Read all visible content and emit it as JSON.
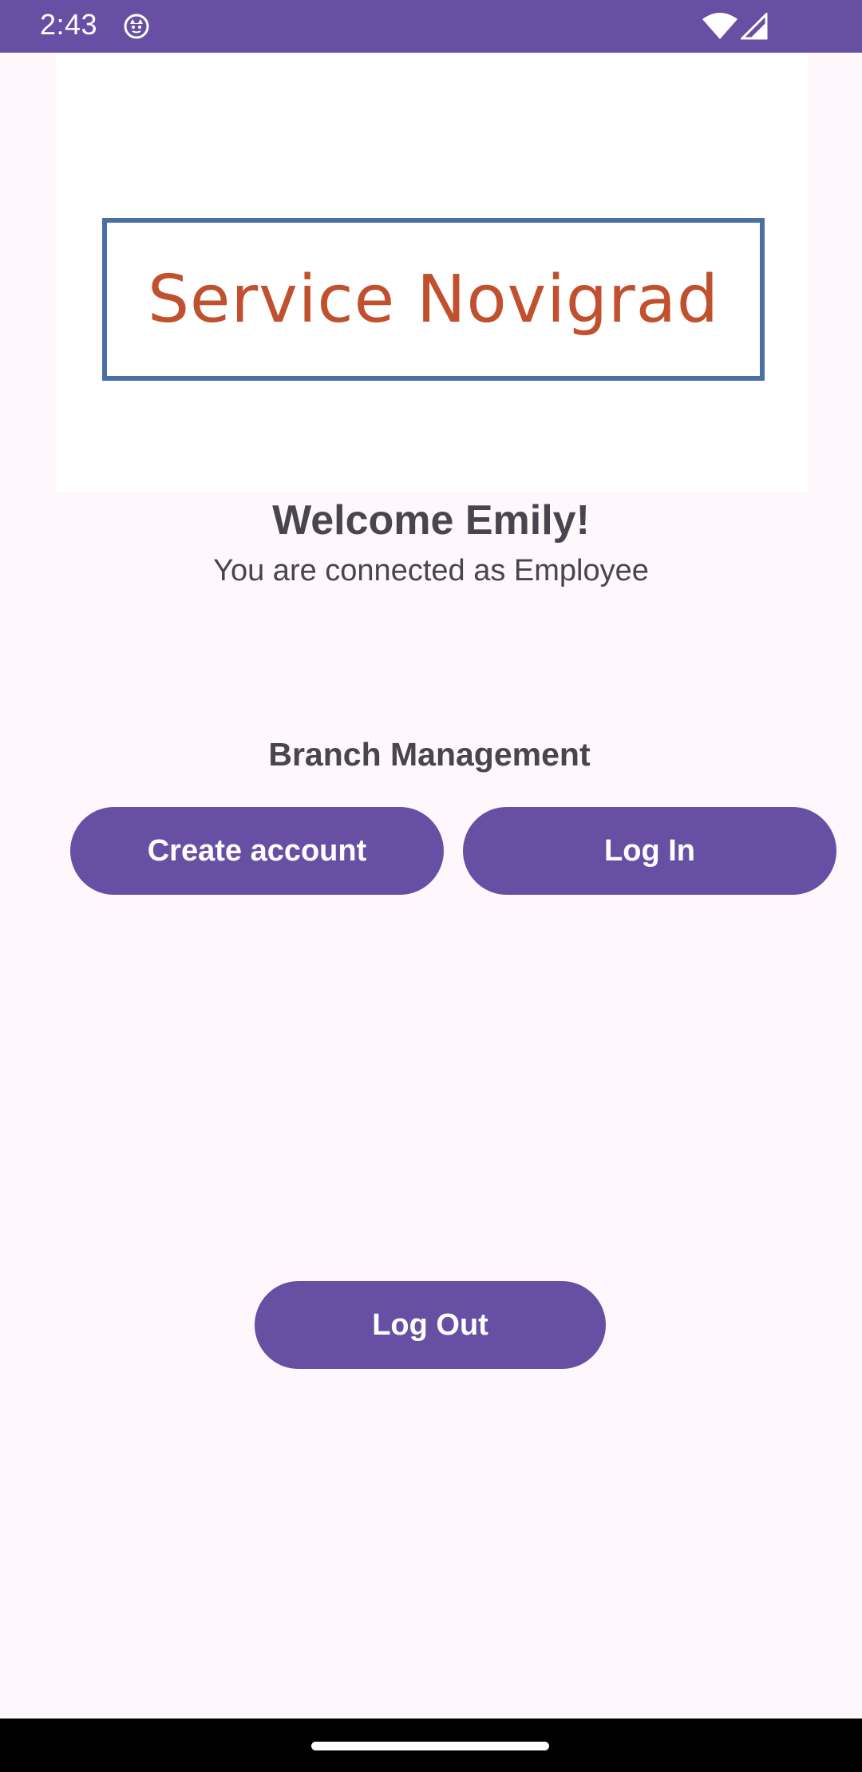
{
  "status_bar": {
    "time": "2:43",
    "background_color": "#6750A4",
    "icons": [
      "app-notification-icon",
      "wifi-icon",
      "cellular-signal-icon"
    ]
  },
  "logo": {
    "text": "Service Novigrad",
    "text_color": "#C0502E",
    "border_color": "#4A6FA5"
  },
  "welcome": {
    "title": "Welcome Emily!",
    "subtitle": "You are connected as Employee"
  },
  "branch_management": {
    "title": "Branch Management",
    "create_account_label": "Create account",
    "log_in_label": "Log In"
  },
  "log_out_label": "Log Out",
  "colors": {
    "primary": "#6750A4",
    "background": "#FEF7FB",
    "text": "#48454E"
  }
}
